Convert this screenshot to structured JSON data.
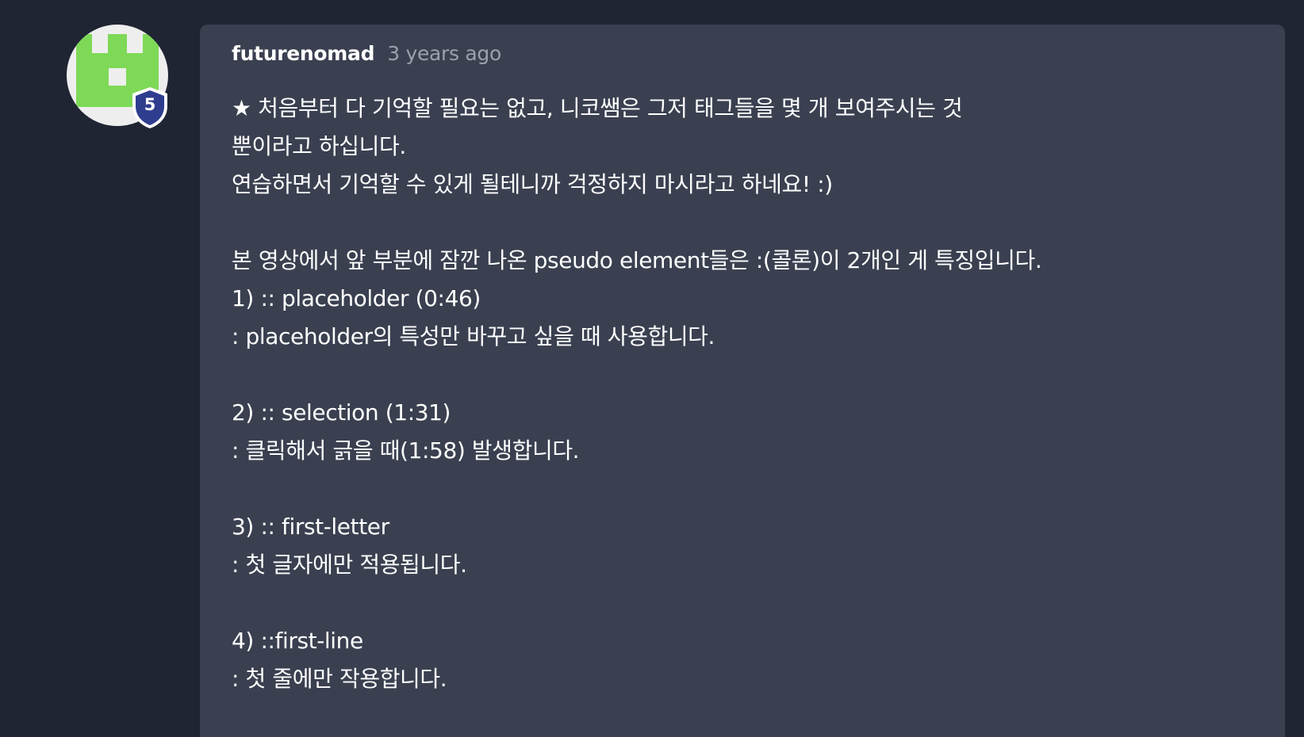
{
  "comment": {
    "author": "futurenomad",
    "time": "3 years ago",
    "level": "5",
    "lines": [
      "★ 처음부터 다 기억할 필요는 없고, 니코쌤은 그저 태그들을 몇 개 보여주시는 것",
      "뿐이라고 하십니다.",
      "연습하면서 기억할 수 있게 될테니까 걱정하지 마시라고 하네요! :)",
      "",
      "본 영상에서 앞 부분에 잠깐 나온 pseudo element들은 :(콜론)이 2개인 게 특징입니다.",
      "1) :: placeholder (0:46)",
      ": placeholder의 특성만 바꾸고 싶을 때 사용합니다.",
      "",
      "2) :: selection (1:31)",
      ": 클릭해서 긁을 때(1:58) 발생합니다.",
      "",
      "3) :: first-letter",
      ": 첫 글자에만 적용됩니다.",
      "",
      "4) ::first-line",
      ": 첫 줄에만 작용합니다."
    ]
  },
  "colors": {
    "page_background": "#1f2533",
    "card_background": "#3a4050",
    "avatar_green": "#7ed957",
    "badge_blue": "#2f3d8f",
    "muted_text": "#9aa1ae"
  },
  "icons": {
    "avatar": "green-pixel-avatar",
    "badge": "level-shield-icon"
  }
}
